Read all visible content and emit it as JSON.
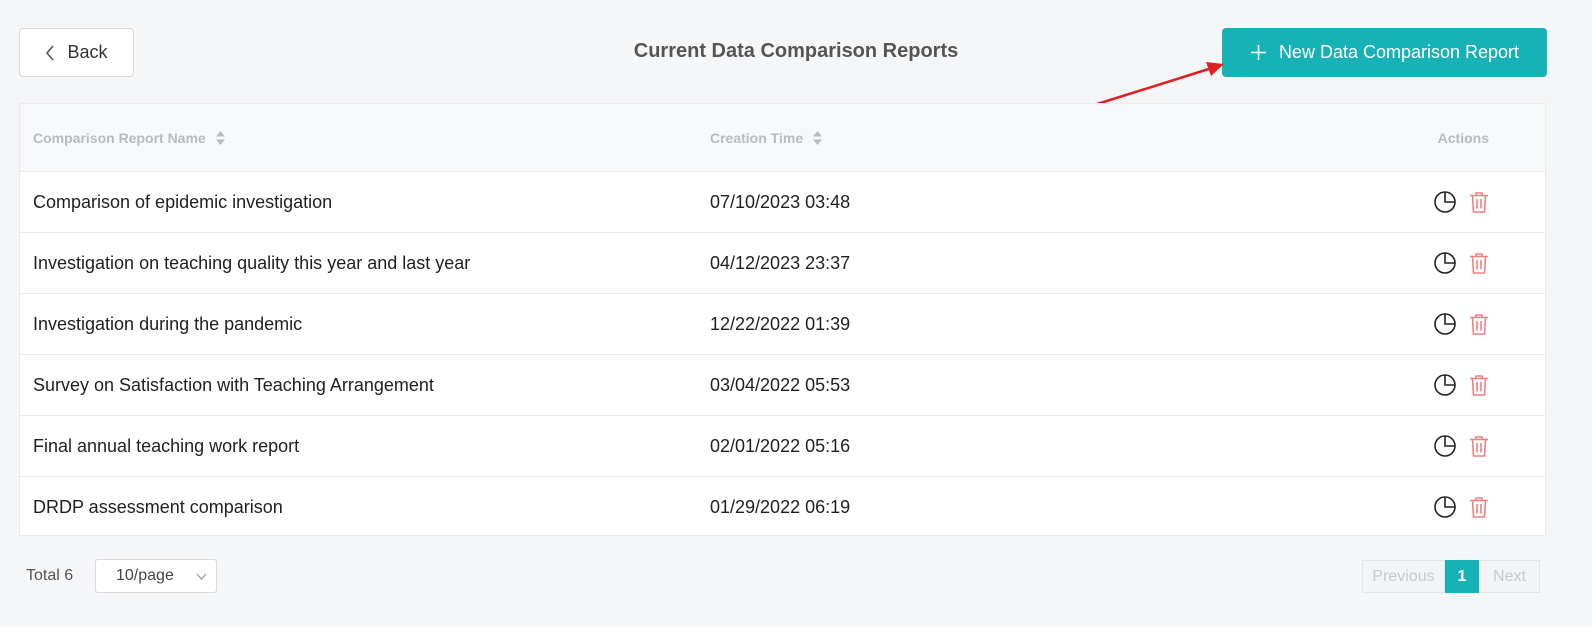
{
  "header": {
    "back_label": "Back",
    "title": "Current Data Comparison Reports",
    "new_label": "New Data Comparison Report"
  },
  "table": {
    "columns": [
      "Comparison Report Name",
      "Creation Time",
      "Actions"
    ],
    "rows": [
      {
        "name": "Comparison of epidemic investigation",
        "time": "07/10/2023 03:48"
      },
      {
        "name": "Investigation on teaching quality this year and last year",
        "time": "04/12/2023 23:37"
      },
      {
        "name": "Investigation during the pandemic",
        "time": "12/22/2022 01:39"
      },
      {
        "name": "Survey on Satisfaction with Teaching Arrangement",
        "time": "03/04/2022 05:53"
      },
      {
        "name": "Final annual teaching work report",
        "time": "02/01/2022 05:16"
      },
      {
        "name": "DRDP assessment comparison",
        "time": "01/29/2022 06:19"
      }
    ],
    "action_icons": [
      "pie-chart-icon",
      "trash-icon"
    ]
  },
  "footer": {
    "total": "Total 6",
    "page_size": "10/page",
    "prev_label": "Previous",
    "current_page": "1",
    "next_label": "Next"
  },
  "colors": {
    "accent": "#16b2b5",
    "delete": "#f08080",
    "annotation": "#e02020"
  }
}
